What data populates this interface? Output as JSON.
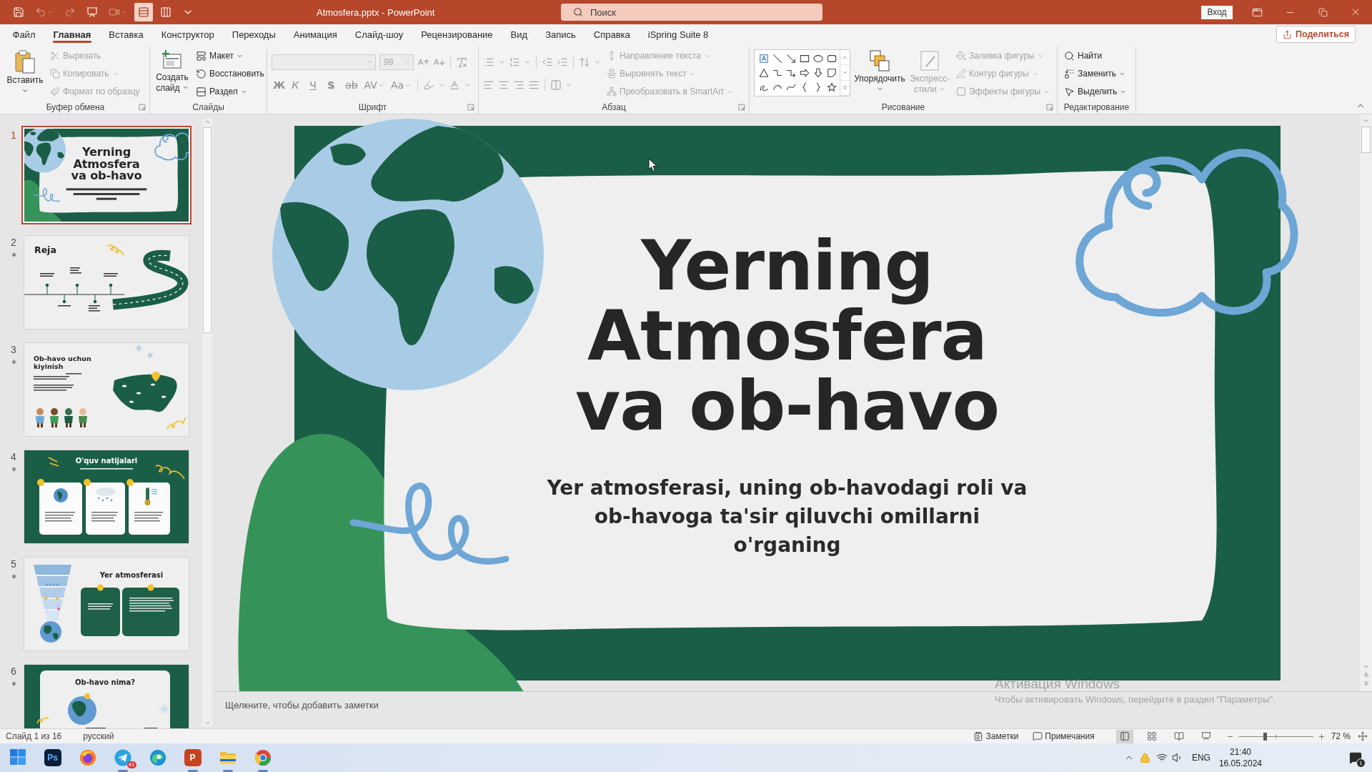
{
  "title_bar": {
    "quick_access": [
      {
        "active": false,
        "disabled": false
      },
      {
        "active": false,
        "disabled": true
      },
      {
        "active": false,
        "disabled": true
      },
      {
        "active": false,
        "disabled": false
      },
      {
        "active": false,
        "disabled": true
      },
      {
        "active": true,
        "disabled": false
      },
      {
        "active": false,
        "disabled": false
      },
      {
        "active": false,
        "disabled": false
      }
    ],
    "document_title": "Atmosfera.pptx - PowerPoint",
    "search": {
      "placeholder": "Поиск"
    },
    "sign_in": "Вход"
  },
  "menu_tabs": [
    {
      "label": "Файл",
      "selected": false
    },
    {
      "label": "Главная",
      "selected": true
    },
    {
      "label": "Вставка",
      "selected": false
    },
    {
      "label": "Конструктор",
      "selected": false
    },
    {
      "label": "Переходы",
      "selected": false
    },
    {
      "label": "Анимация",
      "selected": false
    },
    {
      "label": "Слайд-шоу",
      "selected": false
    },
    {
      "label": "Рецензирование",
      "selected": false
    },
    {
      "label": "Вид",
      "selected": false
    },
    {
      "label": "Запись",
      "selected": false
    },
    {
      "label": "Справка",
      "selected": false
    },
    {
      "label": "iSpring Suite 8",
      "selected": false
    }
  ],
  "share_button": "Поделиться",
  "ribbon": {
    "clipboard": {
      "label": "Буфер обмена",
      "paste": {
        "label": "Вставить",
        "disabled": false
      },
      "actions": [
        {
          "label": "Вырезать",
          "disabled": true
        },
        {
          "label": "Копировать",
          "disabled": true
        },
        {
          "label": "Формат по образцу",
          "disabled": true
        }
      ]
    },
    "slides": {
      "label": "Слайды",
      "new_slide": {
        "label": "Создать слайд",
        "disabled": false
      },
      "actions": [
        {
          "label": "Макет",
          "disabled": false
        },
        {
          "label": "Восстановить",
          "disabled": false
        },
        {
          "label": "Раздел",
          "disabled": false
        }
      ]
    },
    "font": {
      "label": "Шрифт",
      "disabled": true,
      "font_size": "99",
      "styles": [
        "Ж",
        "К",
        "Ч",
        "S",
        "ab",
        "AV",
        "Aa"
      ]
    },
    "paragraph": {
      "label": "Абзац",
      "disabled": true,
      "actions": [
        "Направление текста",
        "Выровнять текст",
        "Преобразовать в SmartArt"
      ]
    },
    "drawing": {
      "label": "Рисование",
      "arrange": {
        "label": "Упорядочить",
        "disabled": false
      },
      "quick_styles": {
        "label": "Экспресс-стили",
        "disabled": true
      },
      "actions": [
        {
          "label": "Заливка фигуры",
          "disabled": true
        },
        {
          "label": "Контур фигуры",
          "disabled": true
        },
        {
          "label": "Эффекты фигуры",
          "disabled": true
        }
      ]
    },
    "editing": {
      "label": "Редактирование",
      "actions": [
        {
          "label": "Найти",
          "disabled": false
        },
        {
          "label": "Заменить",
          "disabled": false
        },
        {
          "label": "Выделить",
          "disabled": false
        }
      ]
    }
  },
  "thumbnails": [
    {
      "number": "1",
      "selected": true,
      "animated": false,
      "kind": "title",
      "title": "Yerning Atmosfera va ob-havo"
    },
    {
      "number": "2",
      "selected": false,
      "animated": true,
      "kind": "agenda",
      "title": "Reja"
    },
    {
      "number": "3",
      "selected": false,
      "animated": true,
      "kind": "clothing",
      "title": "Ob-havo uchun kiyinish"
    },
    {
      "number": "4",
      "selected": false,
      "animated": true,
      "kind": "outcomes",
      "title": "O'quv natijalari"
    },
    {
      "number": "5",
      "selected": false,
      "animated": true,
      "kind": "atmosphere",
      "title": "Yer atmosferasi"
    },
    {
      "number": "6",
      "selected": false,
      "animated": true,
      "kind": "question",
      "title": "Ob-havo nima?"
    }
  ],
  "slide": {
    "title": "Yerning Atmosfera va ob-havo",
    "subtitle": "Yer atmosferasi, uning ob-havodagi roli va ob-havoga ta'sir qiluvchi omillarni o'rganing"
  },
  "notes": {
    "placeholder": "Щелкните, чтобы добавить заметки"
  },
  "activation_notice": {
    "title": "Активация Windows",
    "text": "Чтобы активировать Windows, перейдите в раздел \"Параметры\"."
  },
  "status_bar": {
    "slide_position": "Слайд 1 из 16",
    "language": "русский",
    "notes_button": "Заметки",
    "comments_button": "Примечания",
    "views": [
      {
        "selected": true
      },
      {
        "selected": false
      },
      {
        "selected": false
      },
      {
        "selected": false
      }
    ],
    "zoom": {
      "level": 0.36,
      "reading": "72 %"
    }
  },
  "taskbar": {
    "apps": [
      {
        "kind": "start",
        "running": false
      },
      {
        "kind": "tile",
        "logo": "Ps",
        "running": false
      },
      {
        "kind": "orange_browser",
        "running": false
      },
      {
        "kind": "messenger",
        "badge": "41",
        "running": true
      },
      {
        "kind": "wave_browser",
        "running": false
      },
      {
        "kind": "slides_app",
        "logo": "P",
        "running": true
      },
      {
        "kind": "folder",
        "running": true
      },
      {
        "kind": "ring_browser",
        "running": true
      }
    ],
    "language": "ENG",
    "time": "21:40",
    "date": "16.05.2024",
    "notification_count": "1"
  }
}
